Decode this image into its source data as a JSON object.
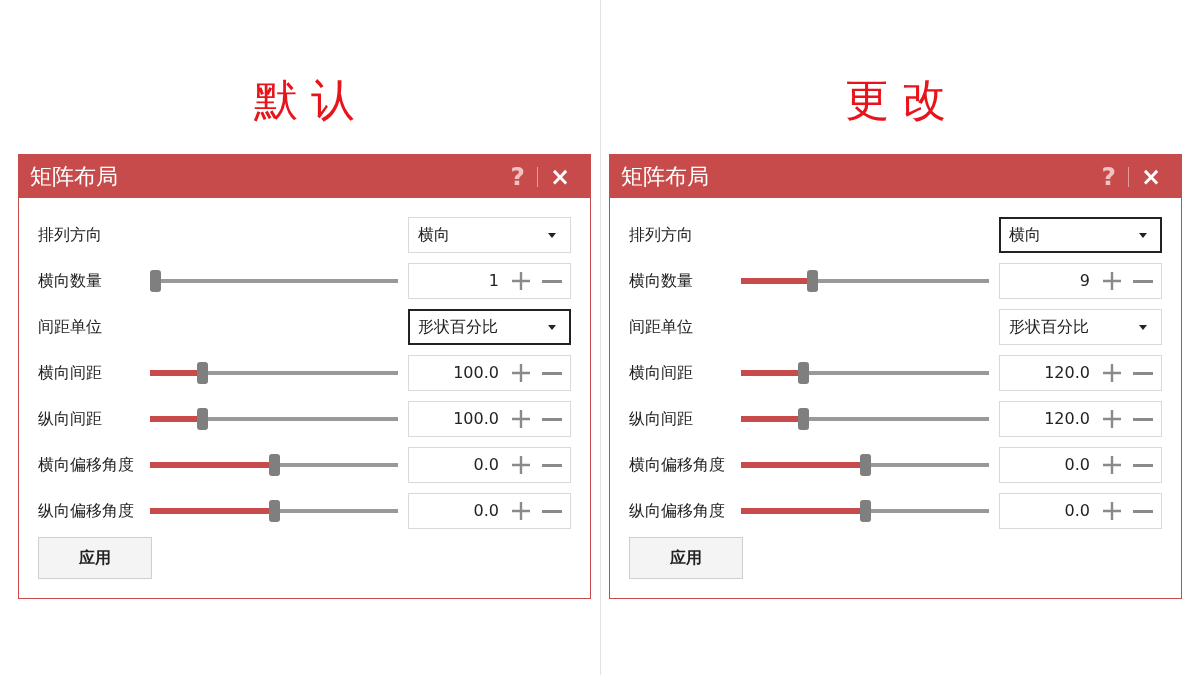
{
  "panels": [
    {
      "heading": "默 认",
      "dialog": {
        "title": "矩阵布局",
        "help_button": "?",
        "close_button": "×",
        "rows": [
          {
            "kind": "dropdown",
            "label": "排列方向",
            "value": "横向",
            "focused": false
          },
          {
            "kind": "slider",
            "label": "横向数量",
            "level": 0,
            "value": "1",
            "focused": false
          },
          {
            "kind": "dropdown",
            "label": "间距单位",
            "value": "形状百分比",
            "focused": true
          },
          {
            "kind": "slider",
            "label": "横向间距",
            "level": 0.2,
            "value": "100.0",
            "focused": false
          },
          {
            "kind": "slider",
            "label": "纵向间距",
            "level": 0.2,
            "value": "100.0",
            "focused": false
          },
          {
            "kind": "slider",
            "label": "横向偏移角度",
            "level": 0.5,
            "value": "0.0",
            "focused": false
          },
          {
            "kind": "slider",
            "label": "纵向偏移角度",
            "level": 0.5,
            "value": "0.0",
            "focused": false
          }
        ],
        "apply_button": "应用"
      }
    },
    {
      "heading": "更 改",
      "dialog": {
        "title": "矩阵布局",
        "help_button": "?",
        "close_button": "×",
        "rows": [
          {
            "kind": "dropdown",
            "label": "排列方向",
            "value": "横向",
            "focused": true
          },
          {
            "kind": "slider",
            "label": "横向数量",
            "level": 0.28,
            "value": "9",
            "focused": false
          },
          {
            "kind": "dropdown",
            "label": "间距单位",
            "value": "形状百分比",
            "focused": false
          },
          {
            "kind": "slider",
            "label": "横向间距",
            "level": 0.24,
            "value": "120.0",
            "focused": false
          },
          {
            "kind": "slider",
            "label": "纵向间距",
            "level": 0.24,
            "value": "120.0",
            "focused": false
          },
          {
            "kind": "slider",
            "label": "横向偏移角度",
            "level": 0.5,
            "value": "0.0",
            "focused": false
          },
          {
            "kind": "slider",
            "label": "纵向偏移角度",
            "level": 0.5,
            "value": "0.0",
            "focused": false
          }
        ],
        "apply_button": "应用"
      }
    }
  ]
}
